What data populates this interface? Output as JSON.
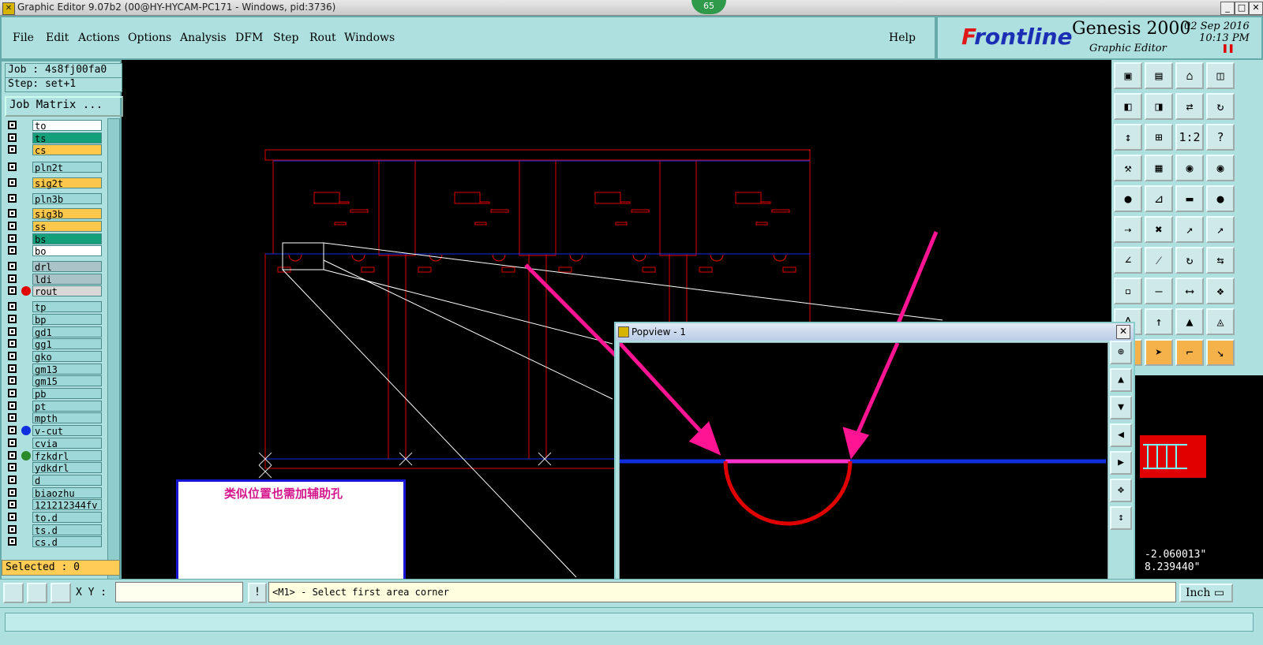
{
  "window": {
    "title": "Graphic Editor 9.07b2 (00@HY-HYCAM-PC171 - Windows, pid:3736)",
    "badge": "65"
  },
  "menu": {
    "items": [
      "File",
      "Edit",
      "Actions",
      "Options",
      "Analysis",
      "DFM",
      "Step",
      "Rout",
      "Windows"
    ],
    "help": "Help"
  },
  "brand": {
    "logo_f": "F",
    "logo_rest": "rontline",
    "product": "Genesis 2000",
    "subtitle": "Graphic Editor",
    "date": "02 Sep 2016",
    "time": "10:13 PM"
  },
  "job": {
    "job_label": "Job : 4s8fj00fa0",
    "step_label": "Step: set+1",
    "matrix_button": "Job Matrix ..."
  },
  "layers": [
    {
      "name": "to",
      "bg": "#ffffff",
      "dot": ""
    },
    {
      "name": "ts",
      "bg": "#13a07a",
      "dot": ""
    },
    {
      "name": "cs",
      "bg": "#ffc84a",
      "dot": ""
    },
    {
      "name": "pln2t",
      "bg": "#9fd8d8",
      "dot": ""
    },
    {
      "name": "sig2t",
      "bg": "#ffc84a",
      "dot": ""
    },
    {
      "name": "pln3b",
      "bg": "#9fd8d8",
      "dot": ""
    },
    {
      "name": "sig3b",
      "bg": "#ffc84a",
      "dot": ""
    },
    {
      "name": "ss",
      "bg": "#ffc84a",
      "dot": ""
    },
    {
      "name": "bs",
      "bg": "#13a07a",
      "dot": ""
    },
    {
      "name": "bo",
      "bg": "#ffffff",
      "dot": ""
    },
    {
      "name": "drl",
      "bg": "#a8c4c8",
      "dot": ""
    },
    {
      "name": "ldi",
      "bg": "#a8c4c8",
      "dot": ""
    },
    {
      "name": "rout",
      "bg": "#d8d8d8",
      "dot": "#e00000"
    },
    {
      "name": "tp",
      "bg": "#9fd8d8",
      "dot": ""
    },
    {
      "name": "bp",
      "bg": "#9fd8d8",
      "dot": ""
    },
    {
      "name": "gd1",
      "bg": "#9fd8d8",
      "dot": ""
    },
    {
      "name": "gg1",
      "bg": "#9fd8d8",
      "dot": ""
    },
    {
      "name": "gko",
      "bg": "#9fd8d8",
      "dot": ""
    },
    {
      "name": "gm13",
      "bg": "#9fd8d8",
      "dot": ""
    },
    {
      "name": "gm15",
      "bg": "#9fd8d8",
      "dot": ""
    },
    {
      "name": "pb",
      "bg": "#9fd8d8",
      "dot": ""
    },
    {
      "name": "pt",
      "bg": "#9fd8d8",
      "dot": ""
    },
    {
      "name": "mpth",
      "bg": "#9fd8d8",
      "dot": ""
    },
    {
      "name": "v-cut",
      "bg": "#9fd8d8",
      "dot": "#1030e0"
    },
    {
      "name": "cvia",
      "bg": "#9fd8d8",
      "dot": ""
    },
    {
      "name": "fzkdrl",
      "bg": "#9fd8d8",
      "dot": "#2a8a2a"
    },
    {
      "name": "ydkdrl",
      "bg": "#9fd8d8",
      "dot": ""
    },
    {
      "name": "d",
      "bg": "#9fd8d8",
      "dot": ""
    },
    {
      "name": "biaozhu",
      "bg": "#9fd8d8",
      "dot": ""
    },
    {
      "name": "121212344fv",
      "bg": "#9fd8d8",
      "dot": ""
    },
    {
      "name": "to.d",
      "bg": "#9fd8d8",
      "dot": ""
    },
    {
      "name": "ts.d",
      "bg": "#9fd8d8",
      "dot": ""
    },
    {
      "name": "cs.d",
      "bg": "#9fd8d8",
      "dot": ""
    }
  ],
  "selected": "Selected : 0",
  "xy_label": "X Y :",
  "message": "<M1> - Select first area corner",
  "unit": "Inch",
  "coords": {
    "x": "-2.060013\"",
    "y": "8.239440\""
  },
  "note": "类似位置也需加辅助孔",
  "popview": {
    "title": "Popview - 1"
  },
  "colors": {
    "panel": "#aee0e0",
    "rout": "#e00000",
    "vcut": "#1030e0",
    "arrow": "#ff1493",
    "note_text": "#d4178c"
  }
}
